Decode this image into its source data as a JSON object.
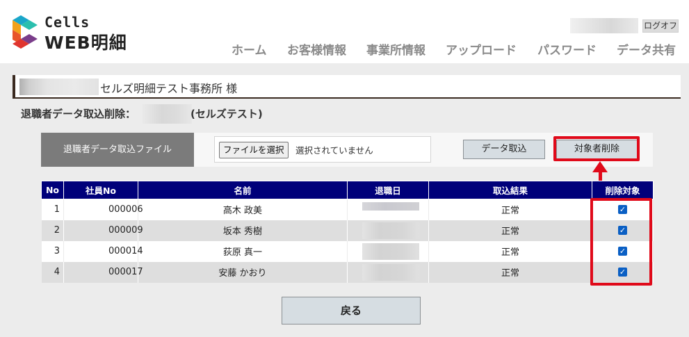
{
  "header": {
    "logo_small": "Cells",
    "logo_big": "WEB明細",
    "logoff_label": "ログオフ",
    "nav": [
      "ホーム",
      "お客様情報",
      "事業所情報",
      "アップロード",
      "パスワード",
      "データ共有"
    ]
  },
  "office": {
    "name": "セルズ明細テスト事務所 様"
  },
  "page": {
    "title": "退職者データ取込削除：",
    "title_suffix": "(セルズテスト)"
  },
  "import": {
    "file_label": "退職者データ取込ファイル",
    "file_button": "ファイルを選択",
    "file_status": "選択されていません",
    "import_button": "データ取込",
    "delete_button": "対象者削除"
  },
  "table": {
    "headers": [
      "No",
      "社員No",
      "名前",
      "退職日",
      "取込結果",
      "削除対象"
    ],
    "rows": [
      {
        "no": "1",
        "emp_no": "000006",
        "name": "高木 政美",
        "result": "正常",
        "checked": true
      },
      {
        "no": "2",
        "emp_no": "000009",
        "name": "坂本 秀樹",
        "result": "正常",
        "checked": true
      },
      {
        "no": "3",
        "emp_no": "000014",
        "name": "荻原 真一",
        "result": "正常",
        "checked": true
      },
      {
        "no": "4",
        "emp_no": "000017",
        "name": "安藤 かおり",
        "result": "正常",
        "checked": true
      }
    ]
  },
  "back_button": "戻る",
  "colors": {
    "table_header": "#00007a",
    "highlight": "#e00a1a",
    "checkbox": "#0a5fc4"
  }
}
